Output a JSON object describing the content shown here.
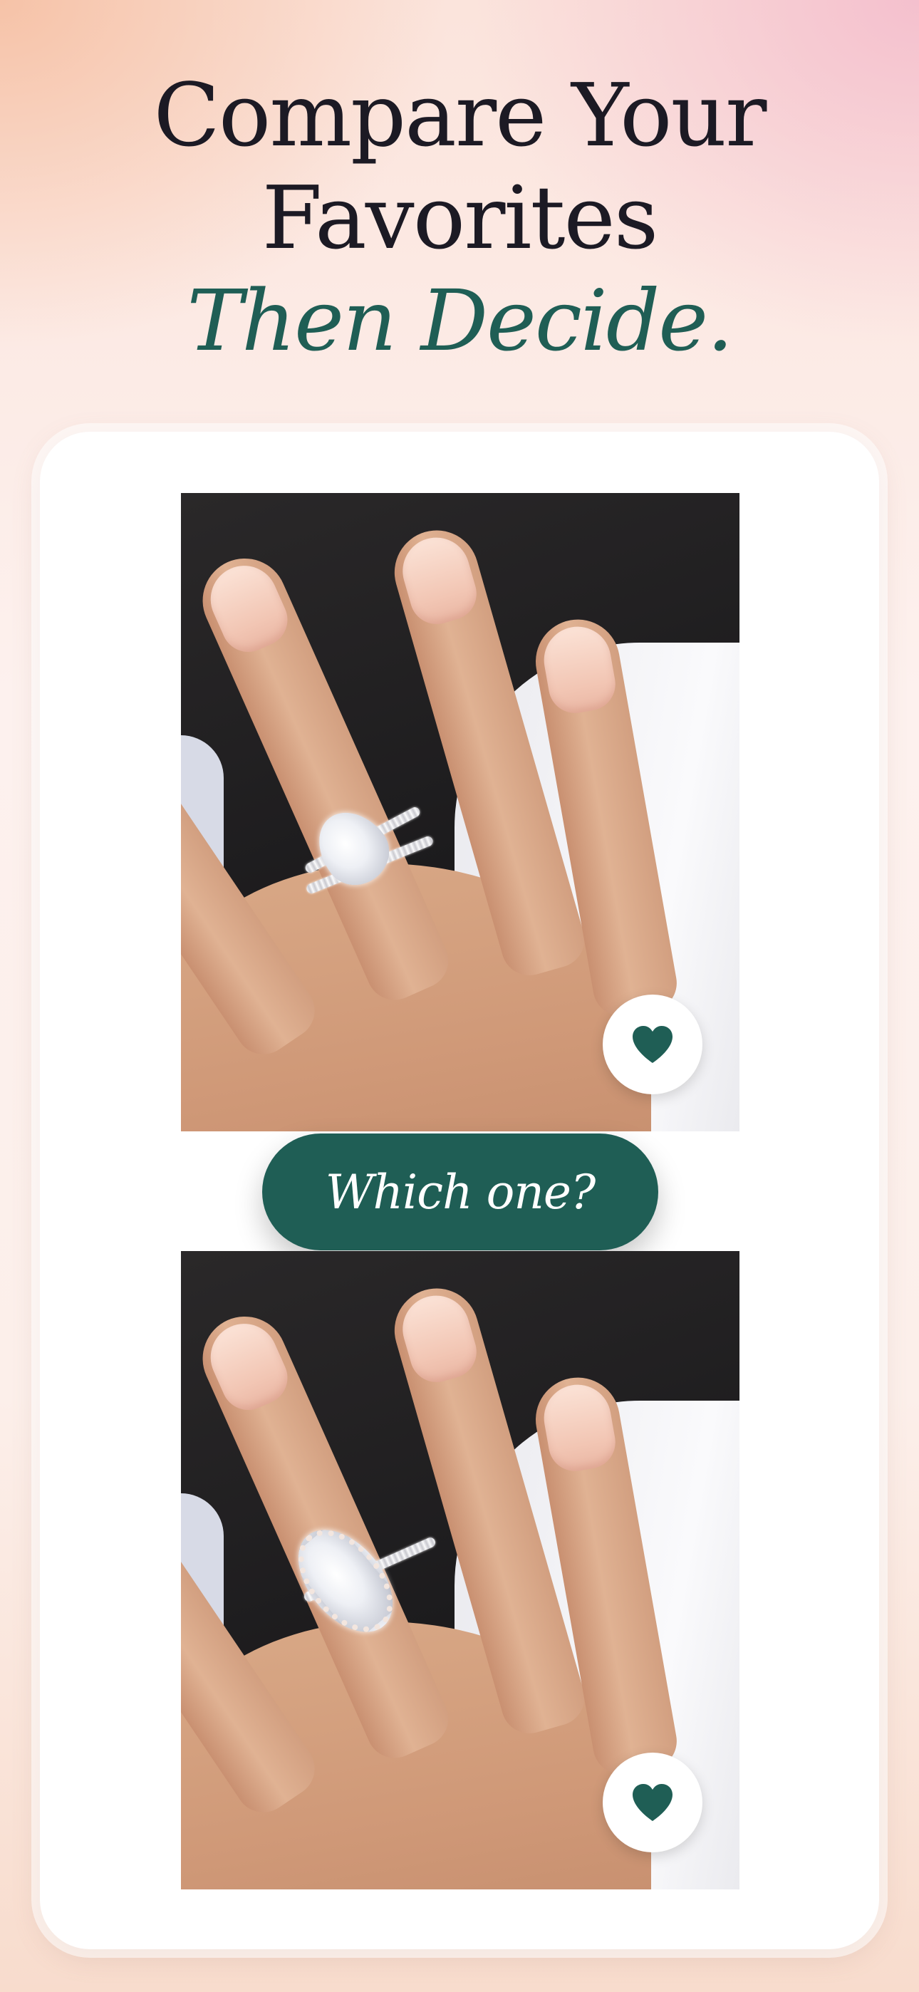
{
  "headline": {
    "line1": "Compare Your",
    "line2": "Favorites",
    "accent": "Then Decide."
  },
  "comparison": {
    "prompt_label": "Which one?",
    "items": [
      {
        "photo_icon": "ring-photo-pear",
        "favorite_icon": "heart-icon"
      },
      {
        "photo_icon": "ring-photo-marquise-halo",
        "favorite_icon": "heart-icon"
      }
    ]
  },
  "colors": {
    "accent_green": "#1f5e55",
    "headline_dark": "#1c1a24",
    "card": "#ffffff"
  }
}
